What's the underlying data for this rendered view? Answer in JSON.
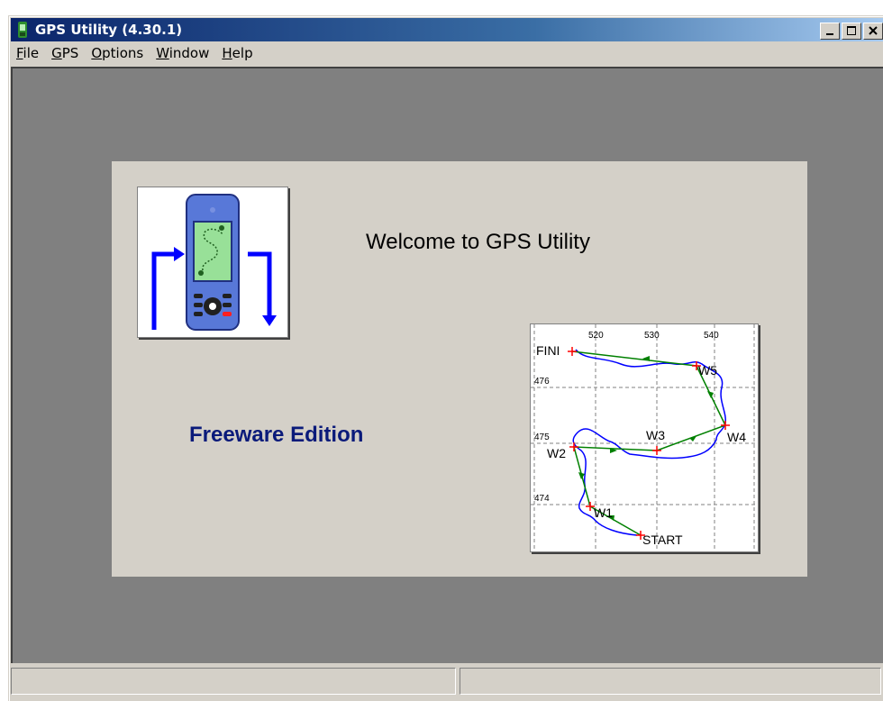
{
  "window": {
    "title": "GPS Utility (4.30.1)",
    "titlebar_gradient_start": "#0a246a",
    "titlebar_gradient_end": "#a6caf0",
    "controls": [
      "minimize-icon",
      "maximize-icon",
      "close-icon"
    ]
  },
  "menu": [
    {
      "underline": "F",
      "rest": "ile"
    },
    {
      "underline": "G",
      "rest": "PS"
    },
    {
      "underline": "O",
      "rest": "ptions"
    },
    {
      "underline": "W",
      "rest": "indow"
    },
    {
      "underline": "H",
      "rest": "elp"
    }
  ],
  "splash": {
    "welcome": "Welcome to GPS Utility",
    "edition": "Freeware Edition",
    "edition_color": "#0a1a7a",
    "logo_icon": "gps-handheld-icon",
    "map": {
      "x_ticks": [
        "520",
        "530",
        "540"
      ],
      "y_ticks": [
        "476",
        "475",
        "474"
      ],
      "waypoints": [
        "FINI",
        "W5",
        "W4",
        "W3",
        "W2",
        "W1",
        "START"
      ],
      "route_color": "#008000",
      "track_color": "#0000ff",
      "waypoint_color": "#ff0000"
    }
  },
  "statusbar": {
    "left": "",
    "right": ""
  }
}
